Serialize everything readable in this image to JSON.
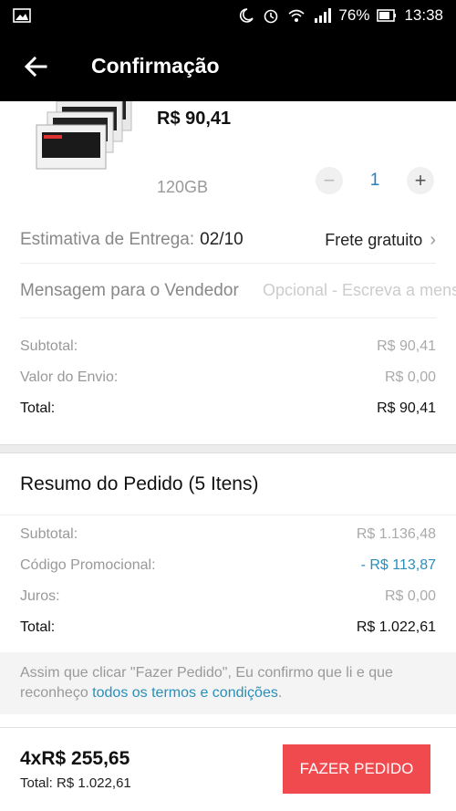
{
  "status": {
    "battery": "76%",
    "time": "13:38"
  },
  "header": {
    "title": "Confirmação"
  },
  "product": {
    "price": "R$ 90,41",
    "variant": "120GB",
    "quantity": "1"
  },
  "delivery": {
    "label": "Estimativa de Entrega:",
    "date": "02/10",
    "shipping": "Frete gratuito"
  },
  "message": {
    "label": "Mensagem para o Vendedor",
    "placeholder": "Opcional - Escreva a mensagem"
  },
  "item_summary": [
    {
      "label": "Subtotal:",
      "value": "R$ 90,41"
    },
    {
      "label": "Valor do Envio:",
      "value": "R$ 0,00"
    },
    {
      "label": "Total:",
      "value": "R$ 90,41"
    }
  ],
  "order_summary": {
    "title": "Resumo do Pedido (5 Itens)",
    "lines": [
      {
        "label": "Subtotal:",
        "value": "R$ 1.136,48"
      },
      {
        "label": "Código Promocional:",
        "value": "- R$ 113,87"
      },
      {
        "label": "Juros:",
        "value": "R$ 0,00"
      },
      {
        "label": "Total:",
        "value": "R$ 1.022,61"
      }
    ]
  },
  "terms": {
    "text_before": "Assim que clicar \"Fazer Pedido\", Eu confirmo que li e que reconheço ",
    "link": "todos os termos e condições",
    "text_after": "."
  },
  "footer": {
    "installment": "4xR$ 255,65",
    "total": "Total: R$ 1.022,61",
    "button": "FAZER PEDIDO"
  },
  "colors": {
    "accent": "#f04a4f",
    "link": "#2a8fb8",
    "bar": "#000000"
  }
}
